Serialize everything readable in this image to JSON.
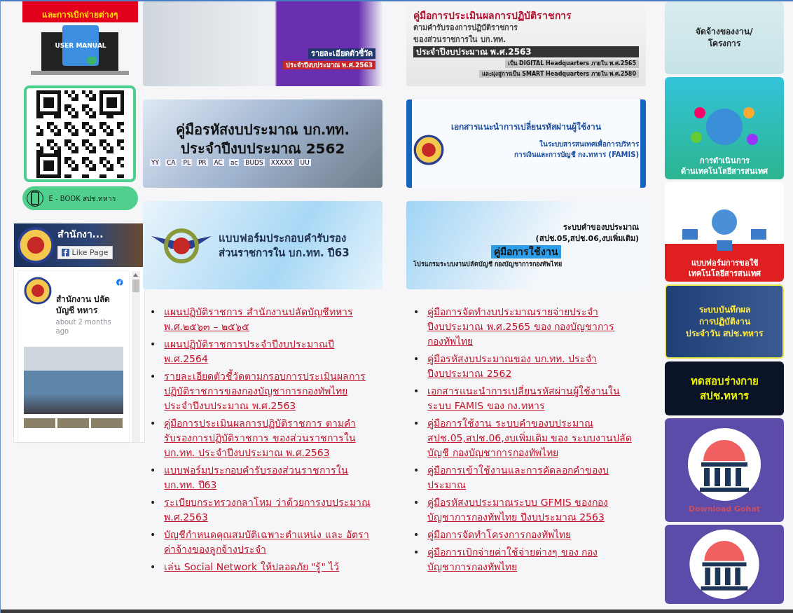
{
  "left_sidebar": {
    "top_banner": "และการเบิกจ่ายต่างๆ",
    "manual_label": "USER MANUAL",
    "ebook_button": "E - BOOK สปช.ทหาร",
    "facebook": {
      "page_name": "สำนักงา...",
      "like_button": "Like Page",
      "post_author": "สำนักงาน ปลัดบัญชี ทหาร",
      "post_time": "about 2 months ago"
    }
  },
  "columns": [
    {
      "banners": [
        {
          "lines": [
            "รายละเอียดตัวชี้วัด",
            "ประจำปีงบประมาณ พ.ศ.2563"
          ]
        },
        {
          "lines": [
            "คู่มือรหัสงบประมาณ บก.ทท.",
            "ประจำปีงบประมาณ 2562"
          ],
          "codes": [
            "YY",
            "CA",
            "PL",
            "PR",
            "AC",
            "ac",
            "BUDS",
            "XXXXX",
            "UU"
          ]
        },
        {
          "lines": [
            "แบบฟอร์มประกอบคำรับรอง",
            "ส่วนราชการใน บก.ทท. ปี63"
          ]
        }
      ],
      "marker": "•",
      "links": [
        "แผนปฏิบัติราชการ สำนักงานปลัดบัญชีทหาร พ.ศ.๒๕๖๓ – ๒๕๖๕",
        "แผนปฏิบัติราชการประจำปีงบประมาณปี พ.ศ.2564",
        "รายละเอียดตัวชี้วัดตามกรอบการประเมินผลการปฏิบัติราชการของกองบัญชาการกองทัพไทย ประจำปีงบประมาณ พ.ศ.2563",
        "คู่มือการประเมินผลการปฏิบัติราชการ ตามคำรับรองการปฏิบัติราชการ ของส่วนราชการใน บก.ทท. ประจำปีงบประมาณ พ.ศ.2563",
        "แบบฟอร์มประกอบคำรับรองส่วนราชการใน บก.ทท. ปี63",
        "ระเบียบกระทรวงกลาโหม ว่าด้วยการงบประมาณ พ.ศ.2563",
        "บัญชีกำหนดคุณสมบัติเฉพาะตำแหน่ง และ อัตราค่าจ้างของลูกจ้างประจำ",
        "เล่น Social Network ให้ปลอดภัย \"รู้\" ไว้"
      ]
    },
    {
      "banners": [
        {
          "lines": [
            "คู่มือการประเมินผลการปฏิบัติราชการ",
            "ตามคำรับรองการปฏิบัติราชการ",
            "ของส่วนราชการใน บก.ทท.",
            "ประจำปีงบประมาณ พ.ศ.2563",
            "เป็น DIGITAL Headquarters ภายใน พ.ศ.2565",
            "และมุ่งสู่การเป็น SMART Headquarters ภายใน พ.ศ.2580"
          ]
        },
        {
          "lines": [
            "เอกสารแนะนำการเปลี่ยนรหัสผ่านผู้ใช้งาน",
            "ในระบบสารสนเทศเพื่อการบริหาร",
            "การเงินและการบัญชี กง.ทหาร (FAMIS)"
          ]
        },
        {
          "lines": [
            "ระบบคำของบประมาณ",
            "(สปช.05,สปช.06,งบเพิ่มเติม)",
            "คู่มือการใช้งาน",
            "โปรแกรมระบบงานปลัดบัญชี กองบัญชาการกองทัพไทย"
          ]
        }
      ],
      "marker": "•",
      "links": [
        "คู่มือการจัดทำงบประมาณรายจ่ายประจำปีงบประมาณ พ.ศ.2565 ของ กองบัญชาการกองทัพไทย",
        "คู่มือรหัสงบประมาณของ บก.ทท. ประจำปีงบประมาณ 2562",
        "เอกสารแนะนำการเปลี่ยนรหัสผ่านผู้ใช้งานในระบบ FAMIS ของ กง.ทหาร",
        "คู่มือการใช้งาน ระบบคำของบประมาณ สปช.05,สปช.06,งบเพิ่มเติม ของ ระบบงานปลัดบัญชี กองบัญชาการกองทัพไทย",
        "คู่มือการเข้าใช้งานและการคัดลอกคำของบประมาณ",
        "คู่มือรหัสงบประมาณระบบ GFMIS ของกองบัญชาการกองทัพไทย ปีงบประมาณ 2563",
        "คู่มือการจัดทำโครงการกองทัพไทย",
        "คู่มือการเบิกจ่ายค่าใช้จ่ายต่างๆ ของ กองบัญชาการกองทัพไทย"
      ]
    }
  ],
  "right_sidebar": {
    "tiles": [
      {
        "kind": "megaphone",
        "lines": [
          "จัดจ้างของงาน/",
          "โครงการ"
        ]
      },
      {
        "kind": "globe",
        "lines": [
          "การดำเนินการ",
          "ด้านเทคโนโลยีสารสนเทศ"
        ]
      },
      {
        "kind": "network",
        "lines": [
          "แบบฟอร์มการขอใช้",
          "เทคโนโลยีสารสนเทศ"
        ]
      },
      {
        "kind": "emblem",
        "lines": [
          "ระบบบันทึกผล",
          "การปฏิบัติงาน",
          "ประจำวัน สปช.ทหาร"
        ]
      },
      {
        "kind": "pulse",
        "lines": [
          "ทดสอบร่างกาย",
          "สปช.ทหาร"
        ]
      },
      {
        "kind": "building",
        "lines": [
          "Download Gohat"
        ]
      },
      {
        "kind": "building"
      }
    ]
  }
}
